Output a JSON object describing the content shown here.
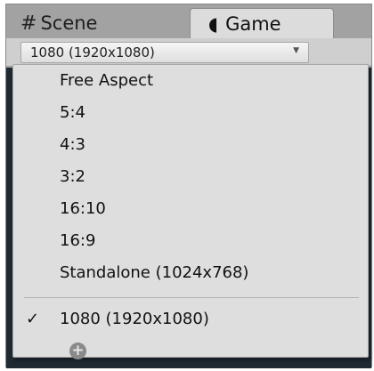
{
  "tabs": {
    "scene": {
      "label": "Scene",
      "icon": "grid-icon",
      "glyph": "#"
    },
    "game": {
      "label": "Game",
      "icon": "pacman-icon",
      "glyph": "◖"
    }
  },
  "toolbar": {
    "resolution_dropdown": {
      "value": "1080 (1920x1080)",
      "arrow": "▼"
    }
  },
  "menu": {
    "items": [
      {
        "label": "Free Aspect",
        "checked": false
      },
      {
        "label": "5:4",
        "checked": false
      },
      {
        "label": "4:3",
        "checked": false
      },
      {
        "label": "3:2",
        "checked": false
      },
      {
        "label": "16:10",
        "checked": false
      },
      {
        "label": "16:9",
        "checked": false
      },
      {
        "label": "Standalone (1024x768)",
        "checked": false
      },
      {
        "label": "1080 (1920x1080)",
        "checked": true,
        "check_glyph": "✓"
      }
    ],
    "add_button_glyph": "+"
  }
}
